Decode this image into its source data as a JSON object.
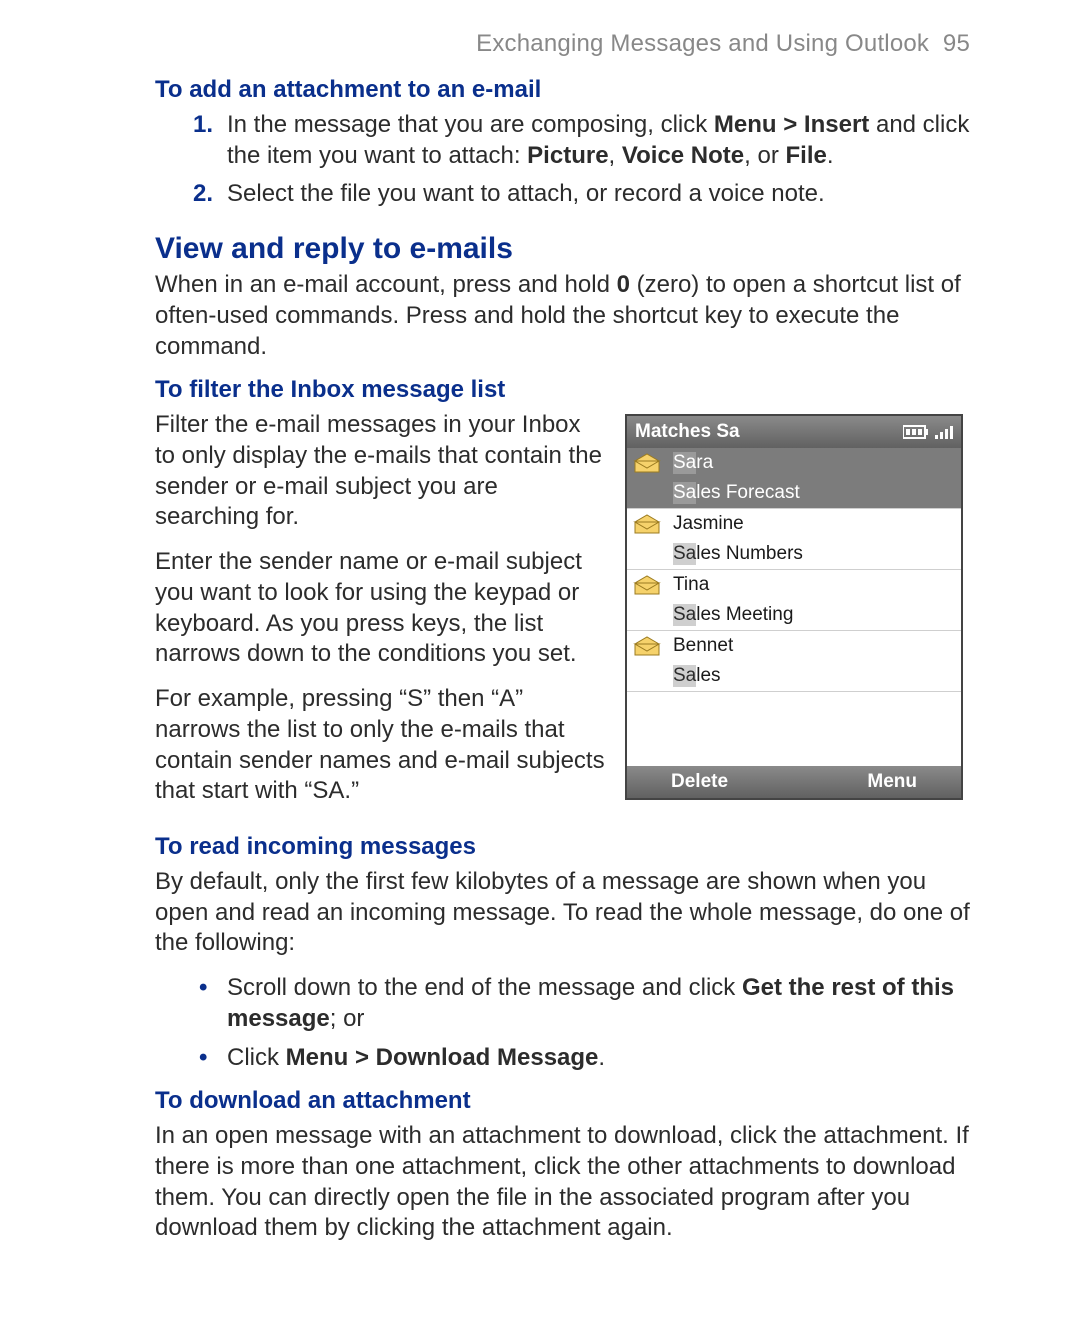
{
  "header": {
    "section": "Exchanging Messages and Using Outlook",
    "page_number": "95"
  },
  "attach": {
    "heading": "To add an attachment to an e-mail",
    "step1_a": "In the message that you are composing, click ",
    "step1_b": "Menu > Insert",
    "step1_c": " and click the item you want to attach: ",
    "step1_d": "Picture",
    "step1_e": ", ",
    "step1_f": "Voice Note",
    "step1_g": ", or ",
    "step1_h": "File",
    "step1_i": ".",
    "step2": "Select the file you want to attach, or record a voice note."
  },
  "view": {
    "heading": "View and reply to e-mails",
    "para_a": "When in an e-mail account, press and hold ",
    "para_b": "0",
    "para_c": " (zero) to open a shortcut list of often-used commands. Press and hold the shortcut key to execute the command."
  },
  "filter": {
    "heading": "To filter the Inbox message list",
    "p1": "Filter the e-mail messages in your Inbox to only display the e-mails that contain the sender or e-mail subject you are searching for.",
    "p2": "Enter the sender name or e-mail subject you want to look for using the keypad or keyboard. As you press keys, the list narrows down to the conditions you set.",
    "p3": "For example, pressing “S” then “A” narrows the list to only the e-mails that contain sender names and e-mail subjects that start with “SA.”"
  },
  "phone": {
    "title_prefix": "Matches",
    "title_query": "Sa",
    "rows": [
      {
        "sender_hl": "Sa",
        "sender_rest": "ra",
        "subject_hl": "Sa",
        "subject_rest": "les Forecast"
      },
      {
        "sender_hl": "",
        "sender_rest": "Jasmine",
        "subject_hl": "Sa",
        "subject_rest": "les Numbers"
      },
      {
        "sender_hl": "",
        "sender_rest": "Tina",
        "subject_hl": "Sa",
        "subject_rest": "les Meeting"
      },
      {
        "sender_hl": "",
        "sender_rest": "Bennet",
        "subject_hl": "Sa",
        "subject_rest": "les"
      }
    ],
    "soft_left": "Delete",
    "soft_right": "Menu"
  },
  "read": {
    "heading": "To read incoming messages",
    "p1": "By default, only the first few kilobytes of a message are shown when you open and read an incoming message. To read the whole message, do one of the following:",
    "b1_a": "Scroll down to the end of the message and click ",
    "b1_b": "Get the rest of this message",
    "b1_c": "; or",
    "b2_a": "Click ",
    "b2_b": "Menu > Download Message",
    "b2_c": "."
  },
  "download": {
    "heading": "To download an attachment",
    "p1": "In an open message with an attachment to download, click the attachment. If there is more than one attachment, click the other attachments to download them. You can directly open the file in the associated program after you download them by clicking the attachment again."
  }
}
